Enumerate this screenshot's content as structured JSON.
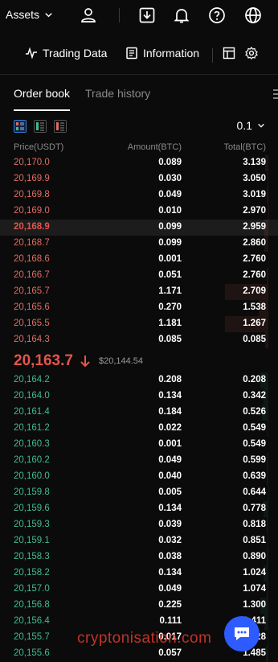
{
  "header": {
    "assets_label": "Assets",
    "icons": [
      "user-icon",
      "download-icon",
      "bell-icon",
      "help-icon",
      "globe-icon"
    ]
  },
  "subnav": {
    "trading_data": "Trading Data",
    "information": "Information",
    "icons": [
      "layout-icon",
      "settings-icon"
    ]
  },
  "tabs": {
    "order_book": "Order book",
    "trade_history": "Trade history"
  },
  "toolbar": {
    "precision": "0.1"
  },
  "columns": {
    "price": "Price(USDT)",
    "amount": "Amount(BTC)",
    "total": "Total(BTC)"
  },
  "asks": [
    {
      "price": "20,170.0",
      "amount": "0.089",
      "total": "3.139"
    },
    {
      "price": "20,169.9",
      "amount": "0.030",
      "total": "3.050"
    },
    {
      "price": "20,169.8",
      "amount": "0.049",
      "total": "3.019"
    },
    {
      "price": "20,169.0",
      "amount": "0.010",
      "total": "2.970"
    },
    {
      "price": "20,168.9",
      "amount": "0.099",
      "total": "2.959"
    },
    {
      "price": "20,168.7",
      "amount": "0.099",
      "total": "2.860"
    },
    {
      "price": "20,168.6",
      "amount": "0.001",
      "total": "2.760"
    },
    {
      "price": "20,166.7",
      "amount": "0.051",
      "total": "2.760"
    },
    {
      "price": "20,165.7",
      "amount": "1.171",
      "total": "2.709"
    },
    {
      "price": "20,165.6",
      "amount": "0.270",
      "total": "1.538"
    },
    {
      "price": "20,165.5",
      "amount": "1.181",
      "total": "1.267"
    },
    {
      "price": "20,164.3",
      "amount": "0.085",
      "total": "0.085"
    }
  ],
  "ticker": {
    "last_price": "20,163.7",
    "index_price": "$20,144.54",
    "direction": "down",
    "down_color": "#e2554c"
  },
  "bids": [
    {
      "price": "20,164.2",
      "amount": "0.208",
      "total": "0.208"
    },
    {
      "price": "20,164.0",
      "amount": "0.134",
      "total": "0.342"
    },
    {
      "price": "20,161.4",
      "amount": "0.184",
      "total": "0.526"
    },
    {
      "price": "20,161.2",
      "amount": "0.022",
      "total": "0.549"
    },
    {
      "price": "20,160.3",
      "amount": "0.001",
      "total": "0.549"
    },
    {
      "price": "20,160.2",
      "amount": "0.049",
      "total": "0.599"
    },
    {
      "price": "20,160.0",
      "amount": "0.040",
      "total": "0.639"
    },
    {
      "price": "20,159.8",
      "amount": "0.005",
      "total": "0.644"
    },
    {
      "price": "20,159.6",
      "amount": "0.134",
      "total": "0.778"
    },
    {
      "price": "20,159.3",
      "amount": "0.039",
      "total": "0.818"
    },
    {
      "price": "20,159.1",
      "amount": "0.032",
      "total": "0.851"
    },
    {
      "price": "20,158.3",
      "amount": "0.038",
      "total": "0.890"
    },
    {
      "price": "20,158.2",
      "amount": "0.134",
      "total": "1.024"
    },
    {
      "price": "20,157.0",
      "amount": "0.049",
      "total": "1.074"
    },
    {
      "price": "20,156.8",
      "amount": "0.225",
      "total": "1.300"
    },
    {
      "price": "20,156.4",
      "amount": "0.111",
      "total": "1.411"
    },
    {
      "price": "20,155.7",
      "amount": "0.017",
      "total": "1.428"
    },
    {
      "price": "20,155.6",
      "amount": "0.057",
      "total": "1.485"
    }
  ],
  "watermark": "cryptonisation.com",
  "colors": {
    "ask": "#e06b62",
    "bid": "#3dbd8f",
    "background": "#0b0b0b",
    "chat_button": "#2e5bff"
  }
}
